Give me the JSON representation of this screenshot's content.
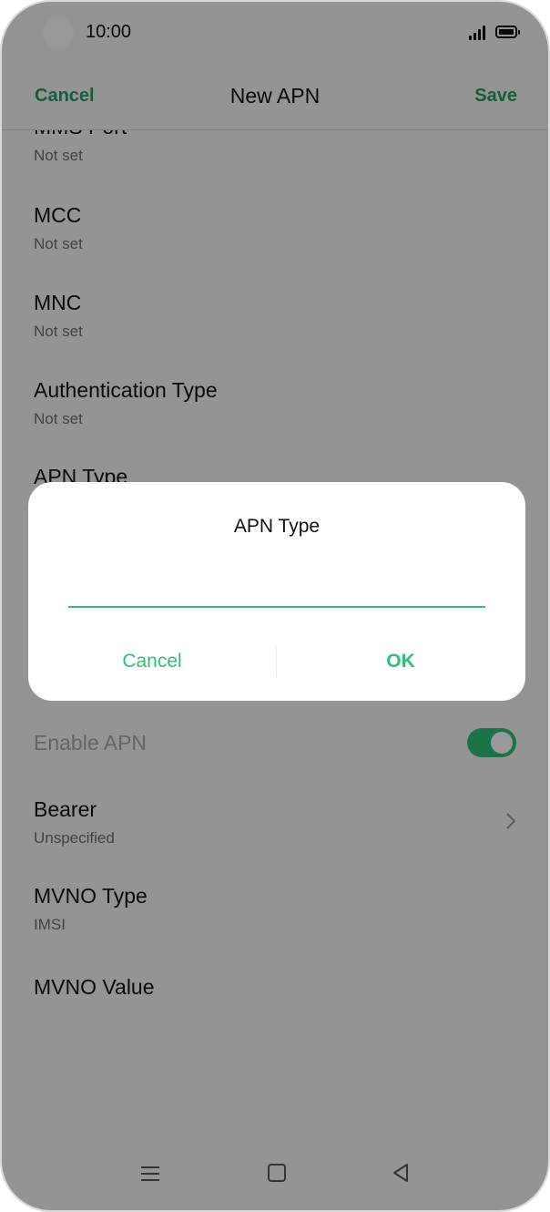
{
  "status_bar": {
    "time": "10:00"
  },
  "header": {
    "cancel_label": "Cancel",
    "title": "New APN",
    "save_label": "Save"
  },
  "list": {
    "mms_port": {
      "title": "MMS Port",
      "value": "Not set"
    },
    "mcc": {
      "title": "MCC",
      "value": "Not set"
    },
    "mnc": {
      "title": "MNC",
      "value": "Not set"
    },
    "auth_type": {
      "title": "Authentication Type",
      "value": "Not set"
    },
    "apn_type": {
      "title": "APN Type"
    },
    "enable_apn": {
      "title": "Enable APN",
      "enabled": true
    },
    "bearer": {
      "title": "Bearer",
      "value": "Unspecified"
    },
    "mvno_type": {
      "title": "MVNO Type",
      "value": "IMSI"
    },
    "mvno_value": {
      "title": "MVNO Value"
    }
  },
  "dialog": {
    "title": "APN Type",
    "input_value": "",
    "cancel_label": "Cancel",
    "ok_label": "OK"
  },
  "colors": {
    "accent": "#2fbf7b",
    "accent_dark": "#1fa063"
  },
  "icons": [
    "signal-icon",
    "battery-icon",
    "chevron-right-icon",
    "menu-icon",
    "home-icon",
    "back-icon"
  ]
}
